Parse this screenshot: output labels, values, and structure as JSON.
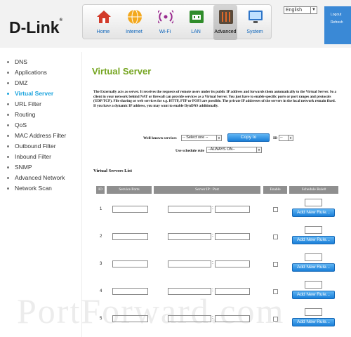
{
  "header": {
    "logo": "D-Link",
    "logo_mark": "®",
    "nav": [
      {
        "label": "Home",
        "icon": "home-icon"
      },
      {
        "label": "Internet",
        "icon": "globe-icon"
      },
      {
        "label": "Wi-Fi",
        "icon": "wifi-icon"
      },
      {
        "label": "LAN",
        "icon": "lan-icon"
      },
      {
        "label": "Advanced",
        "icon": "advanced-icon"
      },
      {
        "label": "System",
        "icon": "monitor-icon"
      }
    ],
    "language": "English",
    "logout": "Logout",
    "refresh": "Refresh"
  },
  "sidebar": {
    "items": [
      {
        "label": "DNS"
      },
      {
        "label": "Applications"
      },
      {
        "label": "DMZ"
      },
      {
        "label": "Virtual Server"
      },
      {
        "label": "URL Filter"
      },
      {
        "label": "Routing"
      },
      {
        "label": "QoS"
      },
      {
        "label": "MAC Address Filter"
      },
      {
        "label": "Outbound Filter"
      },
      {
        "label": "Inbound Filter"
      },
      {
        "label": "SNMP"
      },
      {
        "label": "Advanced Network"
      },
      {
        "label": "Network Scan"
      }
    ],
    "active_index": 3
  },
  "main": {
    "title": "Virtual Server",
    "description": "The Externally acts as server. It receives the requests of remote users under its public IP address and forwards them automatically to the Virtual Server.  So a client in your network behind NAT or firewall can provide services as a Virtual Server. You just have to enable specific ports or port ranges and protocols (UDP/TCP). File sharing or web services for e.g. HTTP, FTP or POP3 are possible. The private IP addresses of the servers in the local network remain fixed. If you have a dynamic IP address, you may want to enable DynDNS additionally.",
    "well_known_label": "Well known services",
    "well_known_value": "-- Select one --",
    "copy_button": "Copy to",
    "id_label": "ID",
    "id_value": "--",
    "schedule_label": "Use schedule rule",
    "schedule_value": "--ALWAYS ON--",
    "section_title": "Virtual Servers List",
    "table": {
      "headers": [
        "ID",
        "Service Ports",
        "Server IP : Port",
        "Enable",
        "Schedule Rule#"
      ],
      "rows": [
        {
          "id": "1",
          "button": "Add New Rule..."
        },
        {
          "id": "2",
          "button": "Add New Rule..."
        },
        {
          "id": "3",
          "button": "Add New Rule..."
        },
        {
          "id": "4",
          "button": "Add New Rule..."
        },
        {
          "id": "5",
          "button": "Add New Rule..."
        }
      ]
    }
  },
  "watermark": "PortForward.com",
  "colors": {
    "title_green": "#75a520",
    "active_blue": "#19a3dd",
    "button_blue": "#1a7fd8",
    "header_gray": "#8f8f8f"
  }
}
